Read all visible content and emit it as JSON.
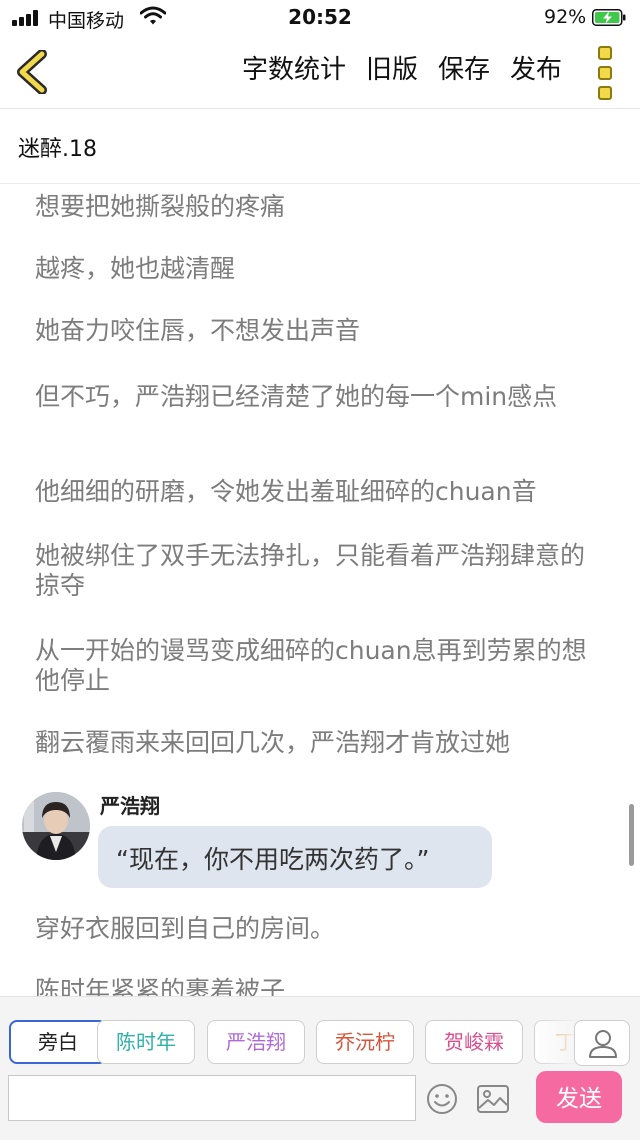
{
  "status_bar": {
    "carrier": "中国移动",
    "time": "20:52",
    "battery": "92%"
  },
  "nav": {
    "actions": [
      "字数统计",
      "旧版",
      "保存",
      "发布"
    ]
  },
  "chapter_title": "迷醉.18",
  "content": {
    "paragraphs_before": [
      "想要把她撕裂般的疼痛",
      "越疼，她也越清醒",
      "她奋力咬住唇，不想发出声音",
      "但不巧，严浩翔已经清楚了她的每一个min感点",
      "他细细的研磨，令她发出羞耻细碎的chuan音",
      "她被绑住了双手无法挣扎，只能看着严浩翔肆意的掠夺",
      "从一开始的谩骂变成细碎的chuan息再到劳累的想他停止",
      "翻云覆雨来来回回几次，严浩翔才肯放过她"
    ],
    "dialogue": {
      "speaker": "严浩翔",
      "text": "“现在，你不用吃两次药了。”"
    },
    "paragraphs_after": [
      "穿好衣服回到自己的房间。",
      "陈时年紧紧的裹着被子"
    ]
  },
  "characters": [
    {
      "name": "旁白",
      "color": "#222222"
    },
    {
      "name": "陈时年",
      "color": "#2fb2a8"
    },
    {
      "name": "严浩翔",
      "color": "#b06ad8"
    },
    {
      "name": "乔沅柠",
      "color": "#d9533a"
    },
    {
      "name": "贺峻霖",
      "color": "#d94f8c"
    },
    {
      "name": "丁",
      "color": "#e8a04a"
    }
  ],
  "composer": {
    "input_value": "",
    "send_label": "发送"
  },
  "colors": {
    "accent_send": "#f66aa2",
    "back_chevron": "#f2d84b",
    "bubble": "#dfe5ee",
    "selected_chip_border": "#3a66d6"
  }
}
